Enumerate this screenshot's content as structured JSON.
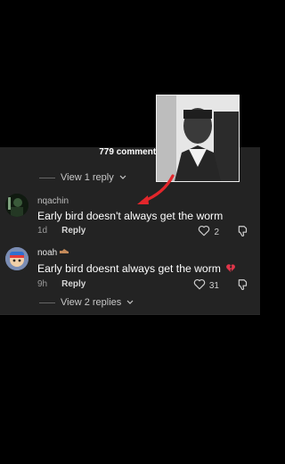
{
  "header": {
    "comment_count": "779 comments"
  },
  "thread": {
    "view_replies_top": "View 1 reply",
    "view_replies_bottom": "View 2 replies"
  },
  "comments": [
    {
      "username": "nqachin",
      "text": "Early bird doesn't always get the worm",
      "age": "1d",
      "reply_label": "Reply",
      "likes": "2"
    },
    {
      "username": "noah",
      "text": "Early bird doesnt always get the worm",
      "age": "9h",
      "reply_label": "Reply",
      "likes": "31"
    }
  ],
  "colors": {
    "arrow": "#e3262b",
    "broken_heart": "#e0364a",
    "panel_bg": "#232323"
  },
  "icons": [
    "heart-outline-icon",
    "thumbs-down-icon",
    "chevron-down-icon",
    "broken-heart-icon",
    "arrow-pointer-icon"
  ]
}
